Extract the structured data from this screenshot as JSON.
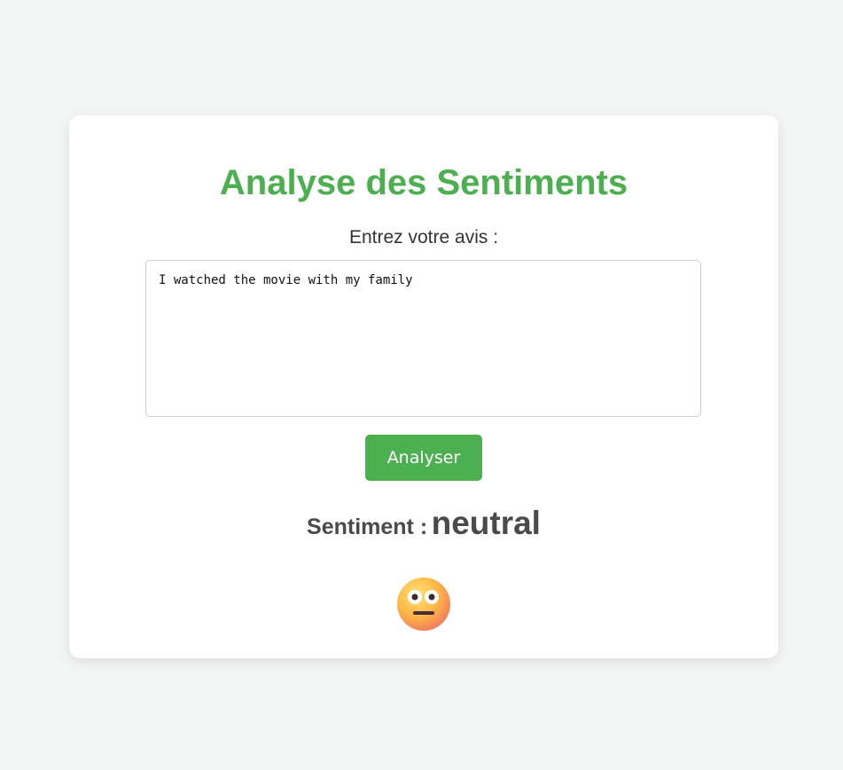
{
  "card": {
    "title": "Analyse des Sentiments",
    "prompt_label": "Entrez votre avis :",
    "review_text": "I watched the movie with my family",
    "analyze_button_label": "Analyser",
    "result_label": "Sentiment :",
    "result_value": "neutral",
    "result_icon": "neutral-face-icon"
  },
  "colors": {
    "accent": "#4caf50",
    "background": "#f4f6f6",
    "text": "#4a4a4a"
  }
}
